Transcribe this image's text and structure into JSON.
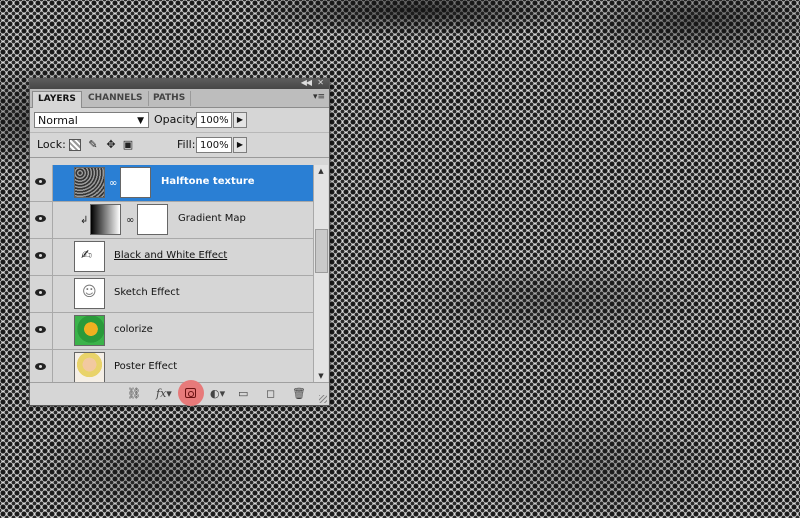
{
  "panel": {
    "tabs": [
      "LAYERS",
      "CHANNELS",
      "PATHS"
    ],
    "blend_mode": "Normal",
    "opacity_label": "Opacity:",
    "opacity_value": "100%",
    "lock_label": "Lock:",
    "fill_label": "Fill:",
    "fill_value": "100%",
    "layers": [
      {
        "name": "Halftone texture",
        "selected": true
      },
      {
        "name": "Gradient Map",
        "selected": false
      },
      {
        "name": "Black and White Effect",
        "selected": false
      },
      {
        "name": "Sketch Effect",
        "selected": false
      },
      {
        "name": "colorize",
        "selected": false
      },
      {
        "name": "Poster Effect",
        "selected": false
      }
    ],
    "footer_icons": [
      "link-layers-icon",
      "fx-icon",
      "add-mask-icon",
      "adjustment-layer-icon",
      "new-group-icon",
      "new-layer-icon",
      "delete-icon"
    ],
    "fx_label": "fx",
    "colors": {
      "selection": "#2a7fd4",
      "highlight": "#e77a7a"
    }
  }
}
